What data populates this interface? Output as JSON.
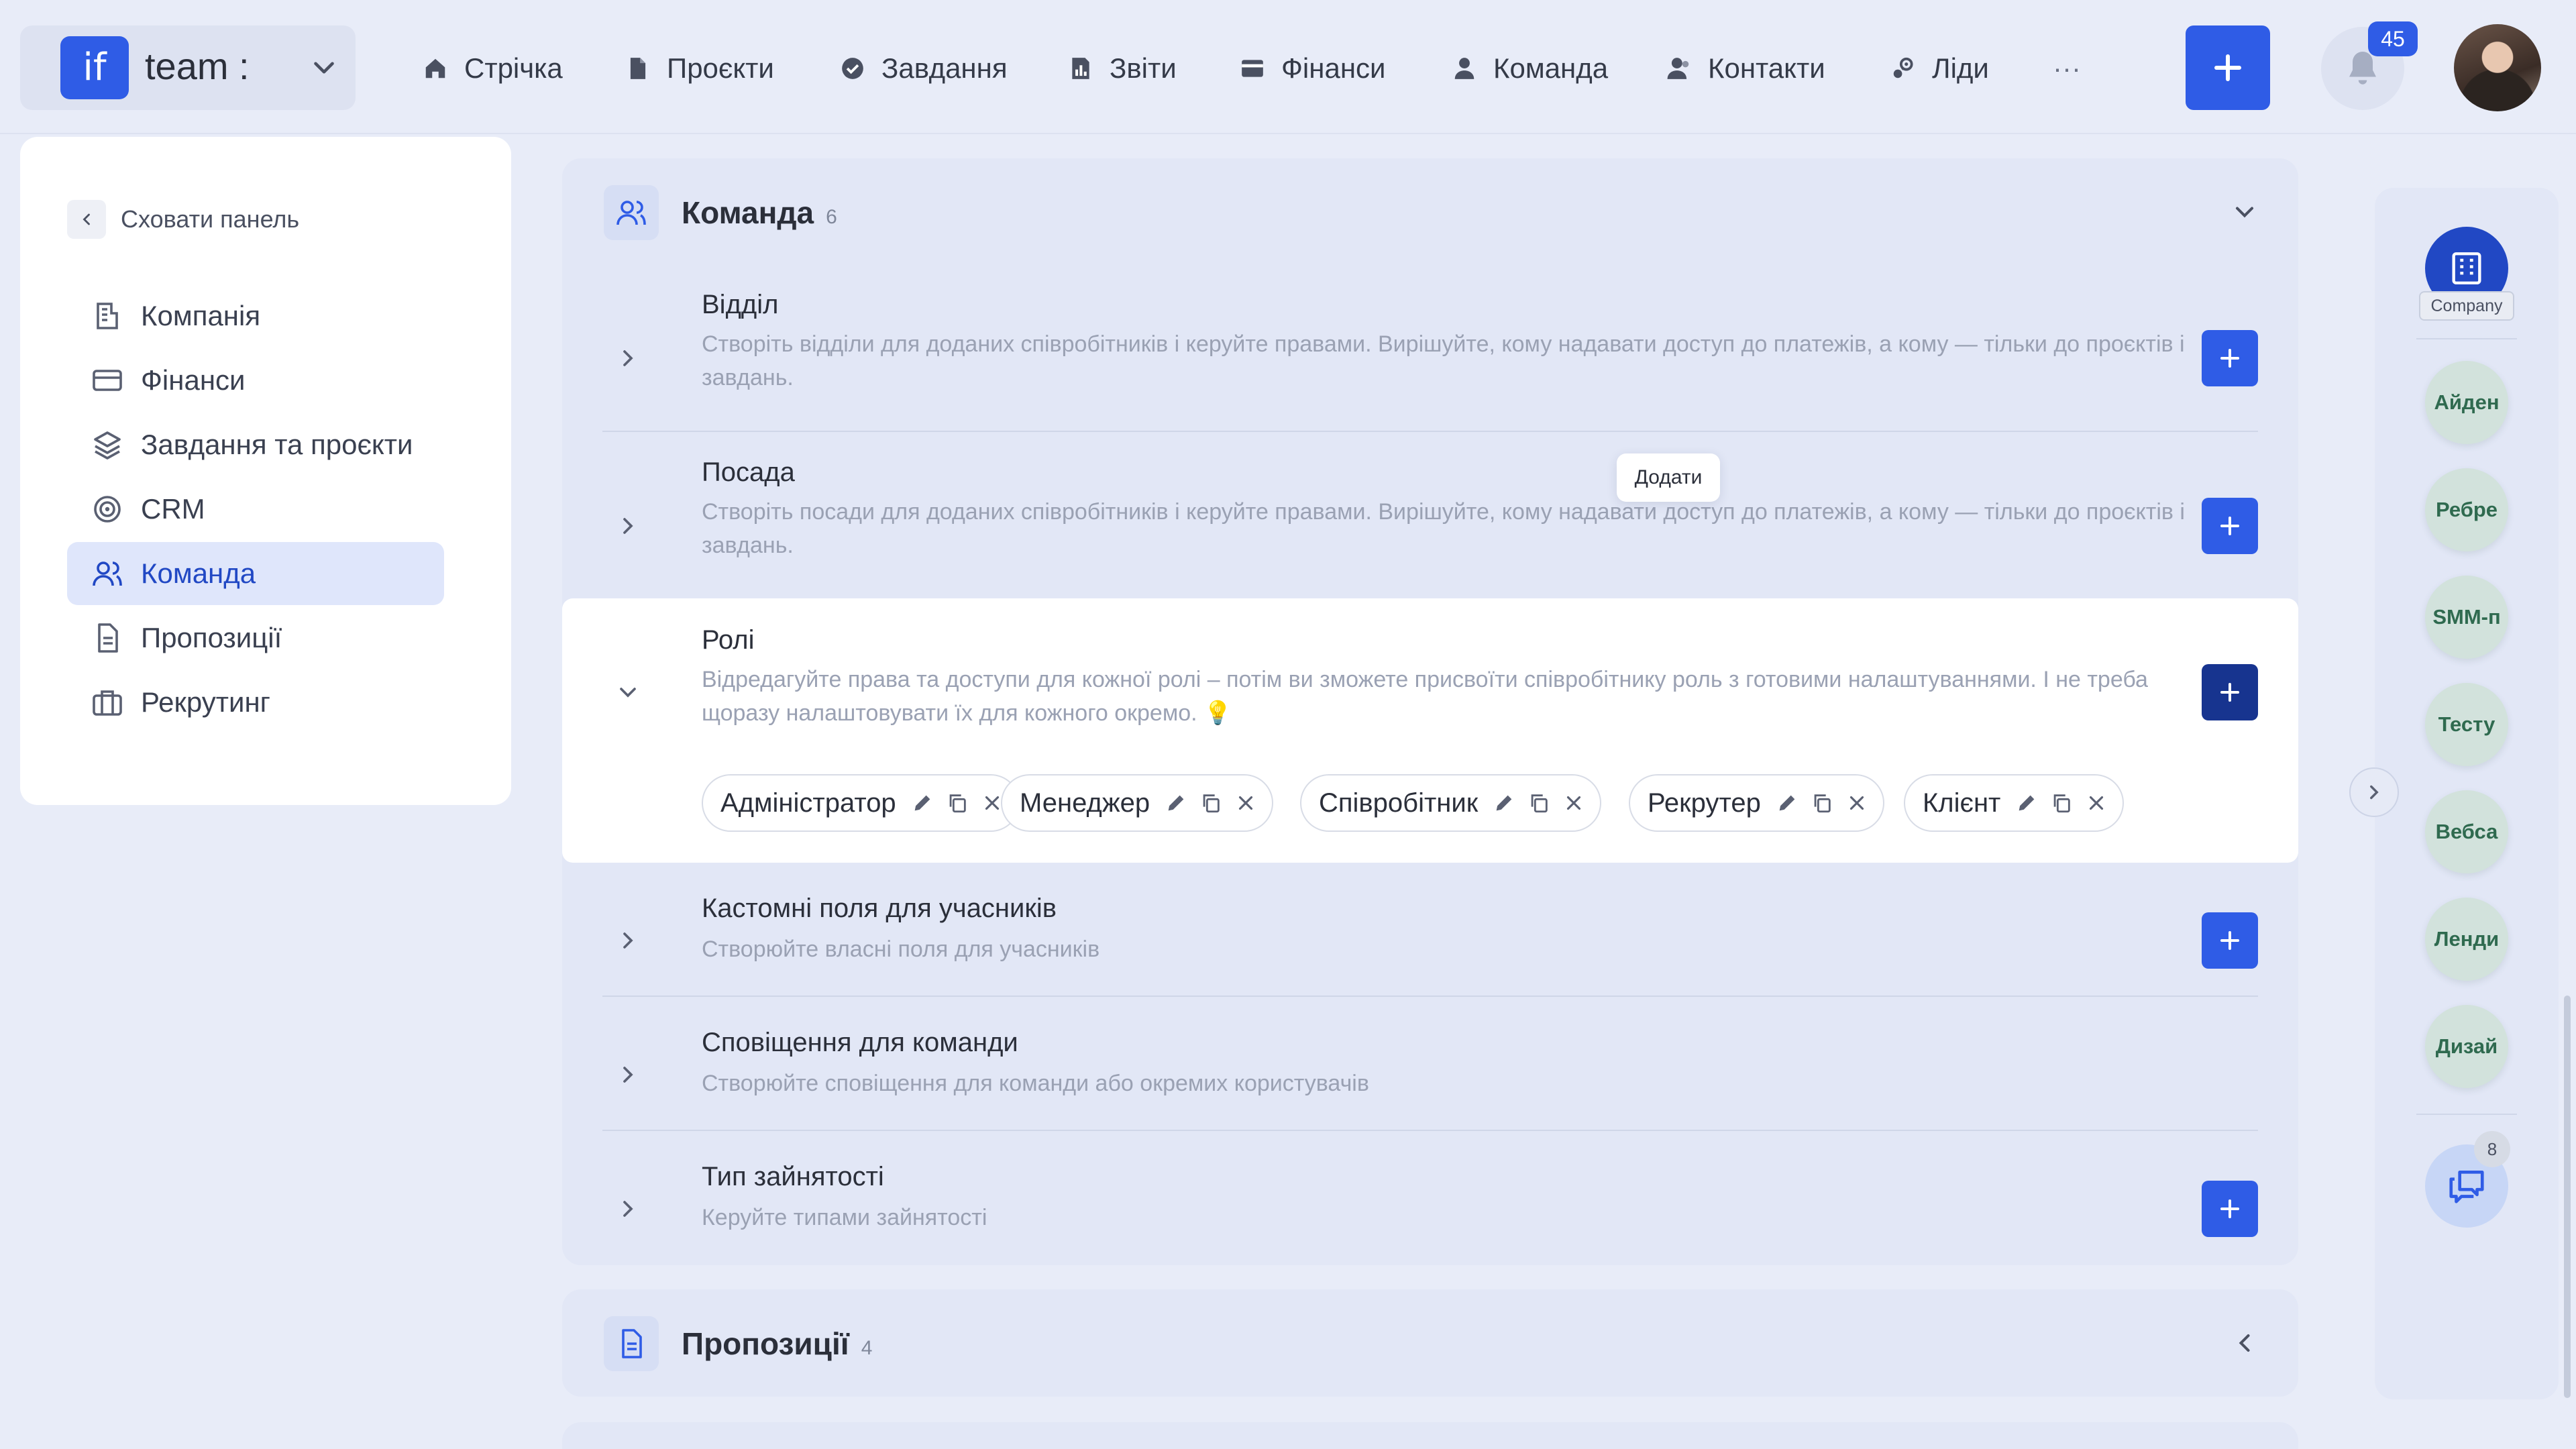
{
  "brand": {
    "logo": "if",
    "name": "team :",
    "chevron_icon": "chevron-down-icon"
  },
  "nav": [
    {
      "label": "Стрічка",
      "icon": "home-icon"
    },
    {
      "label": "Проєкти",
      "icon": "file-icon"
    },
    {
      "label": "Завдання",
      "icon": "check-circle-icon"
    },
    {
      "label": "Звіти",
      "icon": "chart-icon"
    },
    {
      "label": "Фінанси",
      "icon": "wallet-icon"
    },
    {
      "label": "Команда",
      "icon": "user-icon"
    },
    {
      "label": "Контакти",
      "icon": "contacts-icon"
    },
    {
      "label": "Ліди",
      "icon": "leads-icon"
    }
  ],
  "nav_more": "···",
  "notifications": {
    "count": "45"
  },
  "colors": {
    "accent": "#2f5ce6",
    "accent_dark": "#17348f",
    "active_bg": "#dfe6fb",
    "panel": "#e2e7f6"
  },
  "sidebar": {
    "hide_label": "Сховати панель",
    "items": [
      {
        "label": "Компанія",
        "icon": "building-icon",
        "active": false
      },
      {
        "label": "Фінанси",
        "icon": "card-icon",
        "active": false
      },
      {
        "label": "Завдання та проєкти",
        "icon": "layers-icon",
        "active": false
      },
      {
        "label": "CRM",
        "icon": "target-icon",
        "active": false
      },
      {
        "label": "Команда",
        "icon": "users-icon",
        "active": true
      },
      {
        "label": "Пропозиції",
        "icon": "document-icon",
        "active": false
      },
      {
        "label": "Рекрутинг",
        "icon": "briefcase-icon",
        "active": false
      }
    ]
  },
  "team_section": {
    "title": "Команда",
    "count": "6",
    "rows": [
      {
        "title": "Відділ",
        "desc": "Створіть відділи для доданих співробітників і керуйте правами. Вирішуйте, кому надавати доступ до платежів, а кому — тільки до проєктів і завдань."
      },
      {
        "title": "Посада",
        "desc": "Створіть посади для доданих співробітників і керуйте правами. Вирішуйте, кому надавати доступ до платежів, а кому — тільки до проєктів і завдань."
      },
      {
        "title": "Ролі",
        "desc": "Відредагуйте права та доступи для кожної ролі – потім ви зможете присвоїти співробітнику роль з готовими налаштуваннями. І не треба щоразу налаштовувати їх для кожного окремо. 💡"
      },
      {
        "title": "Кастомні поля для учасників",
        "desc": "Створюйте власні поля для учасників"
      },
      {
        "title": "Сповіщення для команди",
        "desc": "Створюйте сповіщення для команди або окремих користувачів"
      },
      {
        "title": "Тип зайнятості",
        "desc": "Керуйте типами зайнятості"
      }
    ],
    "tooltip": "Додати",
    "roles": [
      "Адміністратор",
      "Менеджер",
      "Співробітник",
      "Рекрутер",
      "Клієнт"
    ]
  },
  "proposals_section": {
    "title": "Пропозиції",
    "count": "4"
  },
  "rail": {
    "company_label": "Company",
    "bubbles": [
      "Айден",
      "Ребре",
      "SMM-п",
      "Тесту",
      "Вебса",
      "Ленди",
      "Дизай"
    ],
    "chat_badge": "8"
  }
}
